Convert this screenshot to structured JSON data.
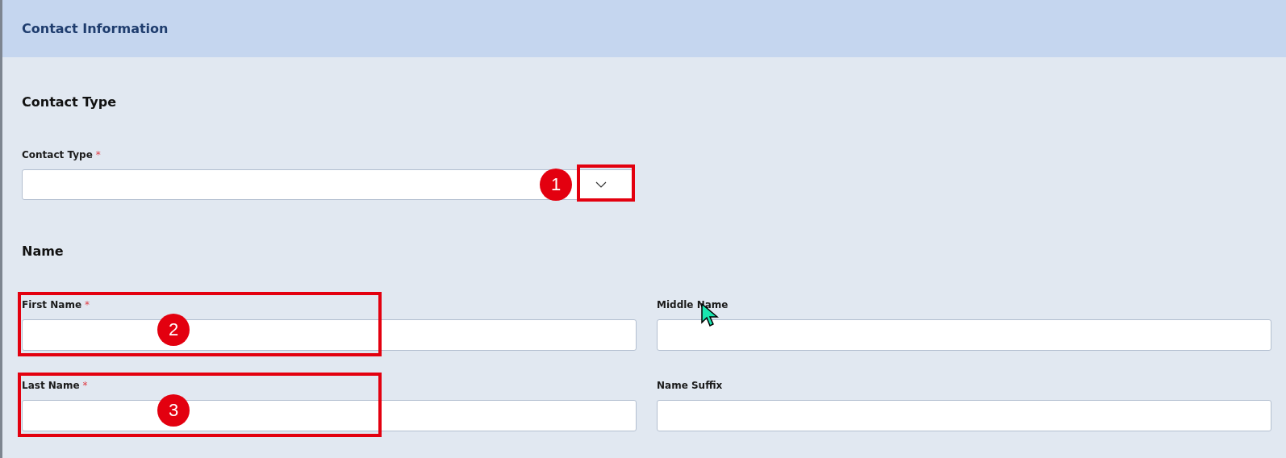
{
  "panel": {
    "title": "Contact Information"
  },
  "sections": [
    {
      "heading": "Contact Type",
      "fields": [
        {
          "kind": "select",
          "label": "Contact Type",
          "required_mark": "*",
          "annotation": "1"
        }
      ]
    },
    {
      "heading": "Name",
      "fields": [
        {
          "kind": "text",
          "label": "First Name",
          "required_mark": "*",
          "annotation": "2"
        },
        {
          "kind": "text",
          "label": "Middle Name"
        },
        {
          "kind": "text",
          "label": "Last Name",
          "required_mark": "*",
          "annotation": "3"
        },
        {
          "kind": "text",
          "label": "Name Suffix"
        }
      ]
    }
  ]
}
